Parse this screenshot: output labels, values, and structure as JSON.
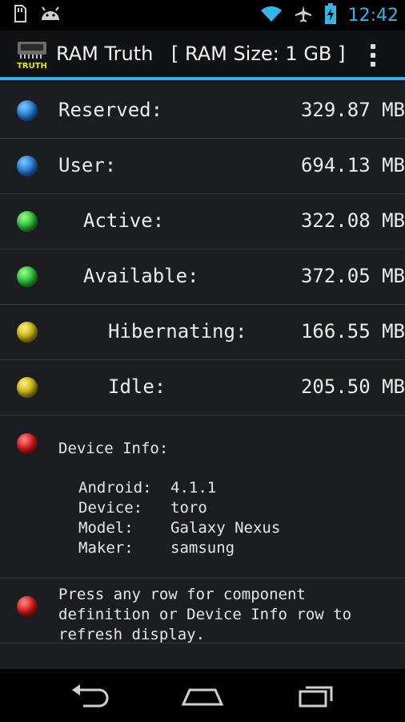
{
  "status_bar": {
    "time": "12:42",
    "icons": [
      "sd-card-icon",
      "android-icon",
      "wifi-icon",
      "airplane-icon",
      "battery-charging-icon"
    ]
  },
  "action_bar": {
    "title": "RAM Truth",
    "subtitle": "[ RAM Size: 1 GB ]",
    "icon_text": "TRUTH"
  },
  "rows": [
    {
      "label": "Reserved:",
      "value": "329.87 MB",
      "color": "blue"
    },
    {
      "label": "User:",
      "value": "694.13 MB",
      "color": "blue"
    },
    {
      "label": "Active:",
      "value": "322.08 MB",
      "color": "green"
    },
    {
      "label": "Available:",
      "value": "372.05 MB",
      "color": "green"
    },
    {
      "label": "Hibernating:",
      "value": "166.55 MB",
      "color": "yellow"
    },
    {
      "label": "Idle:",
      "value": "205.50 MB",
      "color": "yellow"
    }
  ],
  "device_info": {
    "title": "Device Info:",
    "android_key": "Android:",
    "android_val": "4.1.1",
    "device_key": "Device:",
    "device_val": "toro",
    "model_key": "Model:",
    "model_val": "Galaxy Nexus",
    "maker_key": "Maker:",
    "maker_val": "samsung"
  },
  "help": {
    "line1": "Press any row for component",
    "line2": "definition or Device Info row to",
    "line3": "refresh display."
  },
  "colors": {
    "accent": "#33b5e5",
    "blue": "#2b7fd6",
    "green": "#2fbf3a",
    "yellow": "#c8b21b",
    "red": "#d11f1f"
  }
}
